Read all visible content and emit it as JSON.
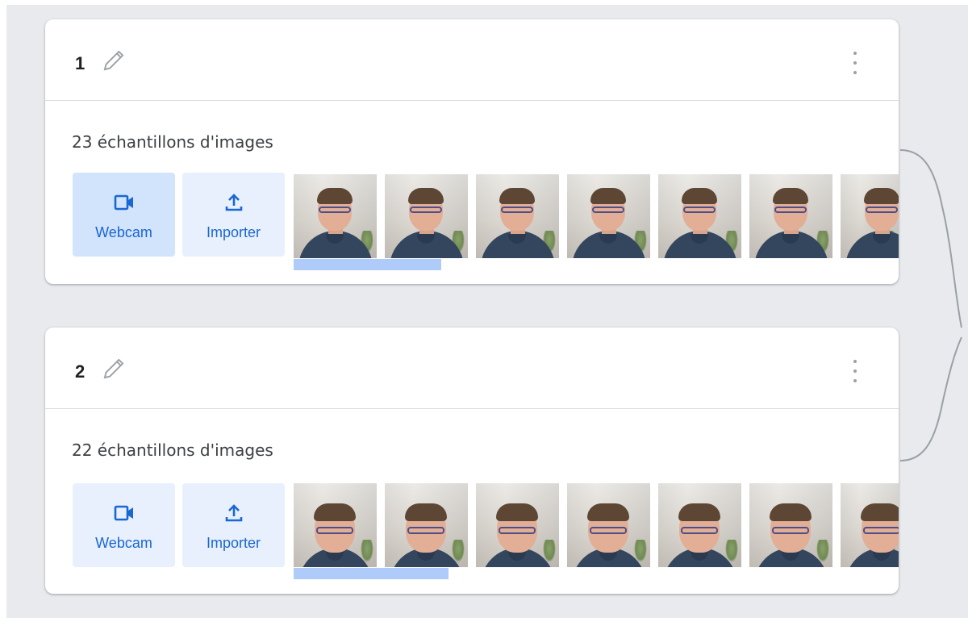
{
  "colors": {
    "background": "#e8eaed",
    "card": "#ffffff",
    "accent": "#1967d2",
    "button_bg": "#e8f0fe",
    "button_active_bg": "#d2e3fc",
    "scroll_thumb": "#aecbfa"
  },
  "classes": [
    {
      "name": "1",
      "samples_label": "23 échantillons d'images",
      "webcam_label": "Webcam",
      "upload_label": "Importer",
      "menu_icon": "more-vertical-icon",
      "edit_icon": "pencil-icon"
    },
    {
      "name": "2",
      "samples_label": "22 échantillons d'images",
      "webcam_label": "Webcam",
      "upload_label": "Importer",
      "menu_icon": "more-vertical-icon",
      "edit_icon": "pencil-icon"
    }
  ]
}
